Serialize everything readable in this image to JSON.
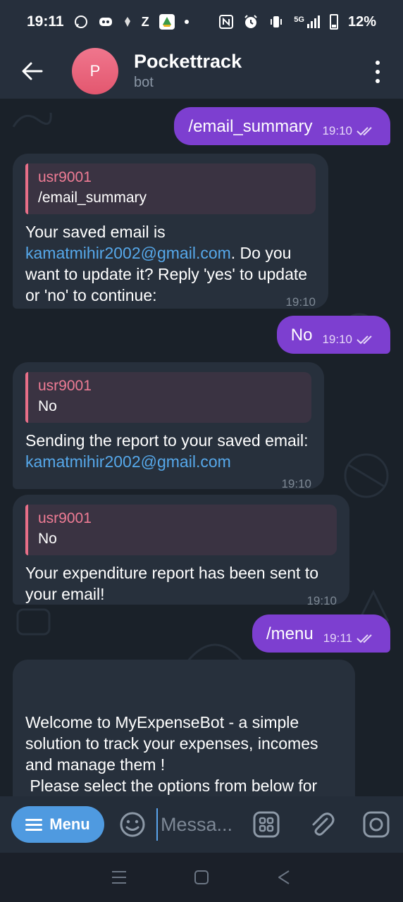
{
  "status_bar": {
    "time": "19:11",
    "notification_icons": [
      "whatsapp-icon",
      "discord-icon",
      "app-icon",
      "z-app-icon",
      "drive-icon"
    ],
    "system_icons": [
      "nfc-icon",
      "alarm-icon",
      "vibrate-icon",
      "signal-5g-icon"
    ],
    "network_label": "5G",
    "battery_percent": "12%"
  },
  "header": {
    "avatar_letter": "P",
    "title": "Pockettrack",
    "subtitle": "bot",
    "avatar_color": "#e8607a"
  },
  "messages": [
    {
      "type": "outgoing",
      "text": "/email_summary",
      "time": "19:10",
      "read": true
    },
    {
      "type": "incoming",
      "reply_name": "usr9001",
      "reply_text": "/email_summary",
      "body_before": "Your saved email is ",
      "link": "kamatmihir2002@gmail.com",
      "body_after": ". Do you want to update it? Reply 'yes' to update or 'no' to continue:",
      "time": "19:10"
    },
    {
      "type": "outgoing",
      "text": "No",
      "time": "19:10",
      "read": true
    },
    {
      "type": "incoming",
      "reply_name": "usr9001",
      "reply_text": "No",
      "body_before": "Sending the report to your saved email: ",
      "link": "kamatmihir2002@gmail.com",
      "time": "19:10"
    },
    {
      "type": "incoming",
      "reply_name": "usr9001",
      "reply_text": "No",
      "body": "Your expenditure report has been sent to your email!",
      "time": "19:10"
    },
    {
      "type": "outgoing",
      "text": "/menu",
      "time": "19:11",
      "read": true
    },
    {
      "type": "incoming",
      "body": "Welcome to MyExpenseBot - a simple solution to track your expenses, incomes and manage them !\n Please select the options from below for me to assist you with:"
    }
  ],
  "input_bar": {
    "menu_label": "Menu",
    "placeholder": "Messa..."
  },
  "colors": {
    "outgoing_bubble": "#7d3fd0",
    "incoming_bubble": "#27303c",
    "link": "#56a8ea",
    "reply_name": "#ef7c95",
    "menu_button": "#4f9ae0"
  }
}
